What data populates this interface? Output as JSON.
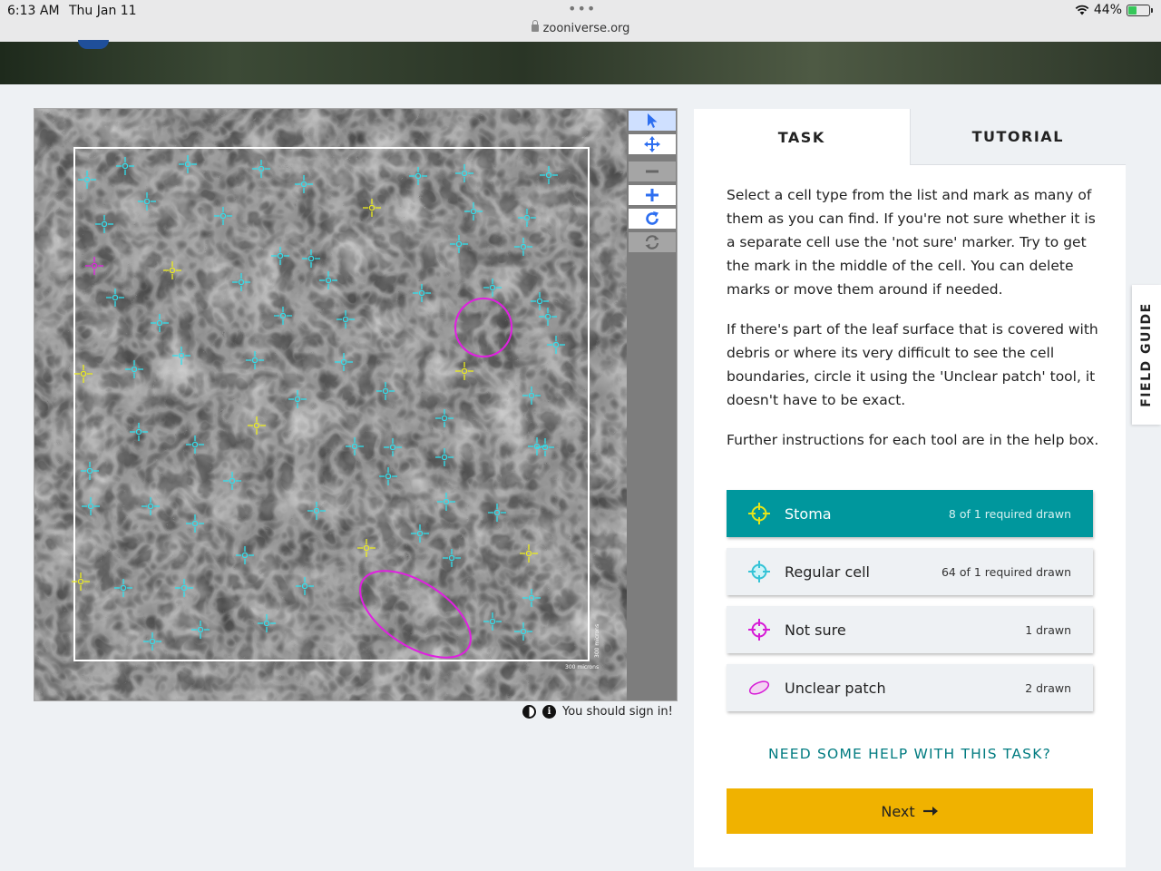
{
  "status_bar": {
    "time": "6:13 AM",
    "date": "Thu Jan 11",
    "url": "zooniverse.org",
    "battery": "44%",
    "battery_level": 0.44
  },
  "viewer": {
    "scale_label_horizontal": "300 microns",
    "scale_label_vertical": "300 microns",
    "sign_in_text": "You should sign in!",
    "tools": [
      "pointer-icon",
      "move-icon",
      "zoom-out-icon",
      "zoom-in-icon",
      "rotate-icon",
      "reset-icon"
    ]
  },
  "panel": {
    "tabs": {
      "task": "TASK",
      "tutorial": "TUTORIAL"
    },
    "instructions": [
      "Select a cell type from the list and mark as many of them as you can find. If you're not sure whether it is a separate cell use the 'not sure' marker. Try to get the mark in the middle of the cell. You can delete marks or move them around if needed.",
      "If there's part of the leaf surface that is covered with debris or where its very difficult to see the cell boundaries, circle it using the 'Unclear patch' tool, it doesn't have to be exact.",
      "Further instructions for each tool are in the help box."
    ],
    "tools": [
      {
        "label": "Stoma",
        "count": "8 of 1 required drawn",
        "color": "#e5e51a",
        "icon": "crosshair-icon"
      },
      {
        "label": "Regular cell",
        "count": "64 of 1 required drawn",
        "color": "#34c3d6",
        "icon": "crosshair-icon"
      },
      {
        "label": "Not sure",
        "count": "1 drawn",
        "color": "#d61bd6",
        "icon": "crosshair-icon"
      },
      {
        "label": "Unclear patch",
        "count": "2 drawn",
        "color": "#d61bd6",
        "icon": "ellipse-icon"
      }
    ],
    "help_link": "NEED SOME HELP WITH THIS TASK?",
    "next_button": "Next",
    "field_guide": "FIELD GUIDE"
  },
  "colors": {
    "accent_teal": "#00979d",
    "next_yellow": "#f0b200",
    "marker_regular": "#2fe0ee",
    "marker_stoma": "#ecec1c",
    "marker_not_sure": "#e020e0",
    "toolbar_active": "#2d6ef0"
  }
}
